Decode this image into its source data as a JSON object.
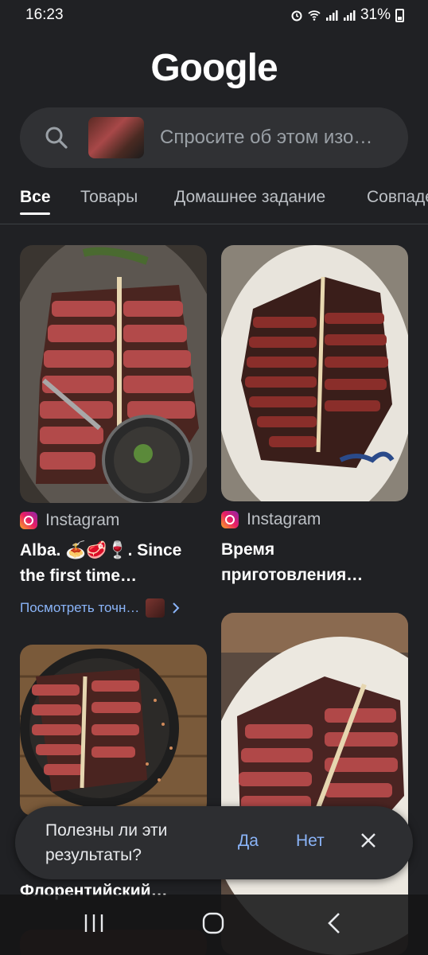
{
  "status": {
    "time": "16:23",
    "battery": "31%"
  },
  "header": {
    "logo_text": "Google"
  },
  "search": {
    "placeholder": "Спросите об этом изо…"
  },
  "tabs": [
    {
      "label": "Все",
      "active": true
    },
    {
      "label": "Товары"
    },
    {
      "label": "Домашнее задание"
    },
    {
      "label": "Совпадения"
    }
  ],
  "results": [
    {
      "source": "Instagram",
      "title": "Alba. 🍝🥩🍷. Since the first time…",
      "link_label": "Посмотреть точн…"
    },
    {
      "source": "Instagram",
      "title": "Время приготовления…"
    },
    {
      "title": "Флорентийский…"
    }
  ],
  "feedback": {
    "question": "Полезны ли эти результаты?",
    "yes": "Да",
    "no": "Нет"
  },
  "icons": [
    "search-icon",
    "close-icon",
    "alarm-icon",
    "wifi-icon",
    "signal-icon",
    "battery-icon",
    "instagram-icon",
    "chevron-right-icon",
    "recents-icon",
    "home-icon",
    "back-icon"
  ],
  "colors": {
    "background": "#202124",
    "link": "#8ab4f8",
    "surface": "#303134"
  }
}
